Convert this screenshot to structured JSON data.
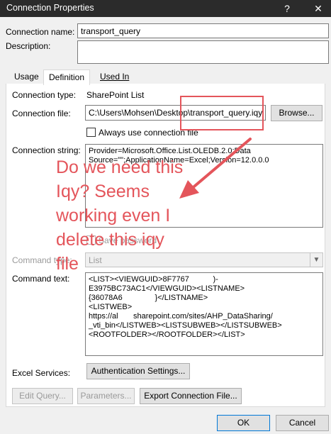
{
  "window": {
    "title": "Connection Properties",
    "help_glyph": "?",
    "close_glyph": "✕"
  },
  "connection": {
    "name_label": "Connection name:",
    "name_value": "transport_query",
    "description_label": "Description:",
    "description_value": ""
  },
  "tabs": [
    {
      "label": "Usage"
    },
    {
      "label": "Definition"
    },
    {
      "label": "Used In"
    }
  ],
  "definition": {
    "type_label": "Connection type:",
    "type_value": "SharePoint List",
    "file_label": "Connection file:",
    "file_value": "C:\\Users\\Mohsen\\Desktop\\transport_query.iqy",
    "browse_label": "Browse...",
    "always_use_label": "Always use connection file",
    "string_label": "Connection string:",
    "string_value": "Provider=Microsoft.Office.List.OLEDB.2.0;Data\nSource=\"\";ApplicationName=Excel;Version=12.0.0.0",
    "save_password_label": "Save password",
    "command_type_label": "Command type:",
    "command_type_value": "List",
    "command_text_label": "Command text:",
    "command_text_value": "<LIST><VIEWGUID>8F7767           )-\nE3975BC73AC1</VIEWGUID><LISTNAME>\n{36078A6               }</LISTNAME>\n<LISTWEB>\nhttps://al       sharepoint.com/sites/AHP_DataSharing/\n_vti_bin</LISTWEB><LISTSUBWEB></LISTSUBWEB>\n<ROOTFOLDER></ROOTFOLDER></LIST>",
    "excel_services_label": "Excel Services:",
    "auth_button_label": "Authentication Settings...",
    "edit_query_label": "Edit Query...",
    "parameters_label": "Parameters...",
    "export_label": "Export Connection File..."
  },
  "footer": {
    "ok_label": "OK",
    "cancel_label": "Cancel"
  },
  "annotation": {
    "text": "Do we need this\nIqy? Seems\nworking even I\ndelete this iqy\nfile",
    "color": "#e4555b"
  }
}
